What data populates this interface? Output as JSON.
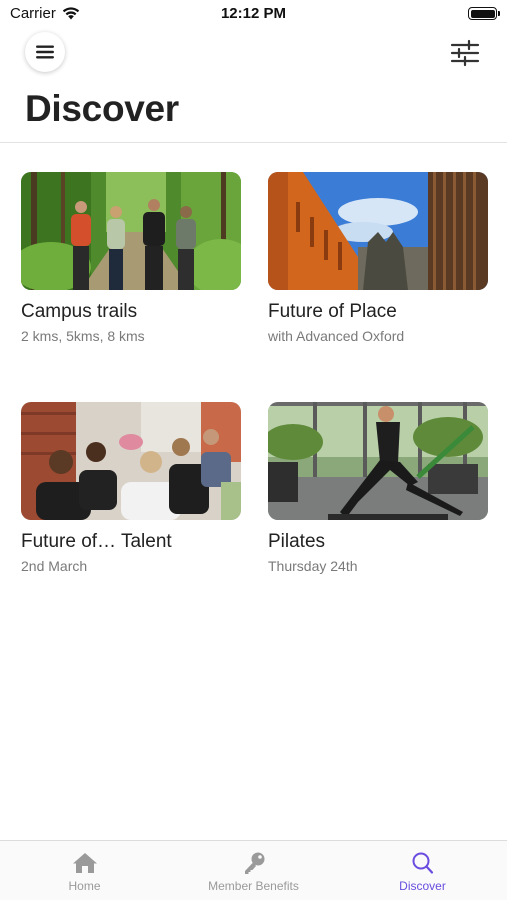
{
  "status_bar": {
    "carrier": "Carrier",
    "time": "12:12 PM"
  },
  "header": {
    "title": "Discover",
    "menu_icon": "hamburger-menu-icon",
    "filter_icon": "sliders-icon"
  },
  "cards": [
    {
      "title": "Campus trails",
      "subtitle": "2 kms, 5kms, 8 kms",
      "image": "group walking on forest trail"
    },
    {
      "title": "Future of Place",
      "subtitle": "with Advanced Oxford",
      "image": "orange building under blue sky"
    },
    {
      "title": "Future of… Talent",
      "subtitle": "2nd March",
      "image": "people seated at an event"
    },
    {
      "title": "Pilates",
      "subtitle": "Thursday 24th",
      "image": "woman stretching in gym"
    }
  ],
  "tab_bar": {
    "tabs": [
      {
        "label": "Home",
        "icon": "home-icon",
        "active": false
      },
      {
        "label": "Member Benefits",
        "icon": "key-icon",
        "active": false
      },
      {
        "label": "Discover",
        "icon": "search-icon",
        "active": true
      }
    ]
  },
  "colors": {
    "accent": "#6a4de0",
    "inactive_tab": "#9a9a9a",
    "title": "#222222",
    "subtitle": "#7a7a7a"
  }
}
